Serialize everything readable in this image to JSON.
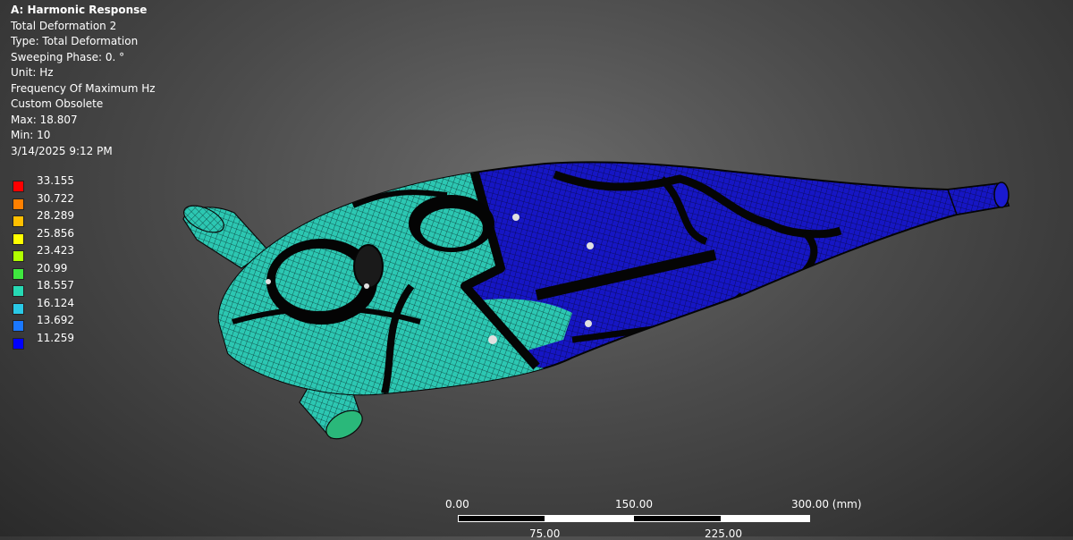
{
  "info": {
    "title": "A: Harmonic Response",
    "result_name": "Total Deformation 2",
    "type": "Type: Total Deformation",
    "sweeping_phase": "Sweeping Phase: 0. °",
    "unit": "Unit: Hz",
    "frequency": "Frequency Of Maximum Hz",
    "custom": "Custom Obsolete",
    "max": "Max: 18.807",
    "min": "Min: 10",
    "timestamp": "3/14/2025 9:12 PM"
  },
  "legend": [
    {
      "value": "33.155",
      "color": "#ff0000"
    },
    {
      "value": "30.722",
      "color": "#ff8000"
    },
    {
      "value": "28.289",
      "color": "#ffbf00"
    },
    {
      "value": "25.856",
      "color": "#ffff00"
    },
    {
      "value": "23.423",
      "color": "#b0ff00"
    },
    {
      "value": "20.99",
      "color": "#3fe83f"
    },
    {
      "value": "18.557",
      "color": "#27d9b4"
    },
    {
      "value": "16.124",
      "color": "#2ac9e6"
    },
    {
      "value": "13.692",
      "color": "#1a78ff"
    },
    {
      "value": "11.259",
      "color": "#0000ff"
    }
  ],
  "scale": {
    "label_0": "0.00",
    "label_150": "150.00",
    "label_300": "300.00 (mm)",
    "label_75": "75.00",
    "label_225": "225.00"
  },
  "colors": {
    "mesh_cyan": "#27c9b4",
    "mesh_blue": "#1010c8",
    "mesh_line": "#0a0a0a",
    "background": "#4b4b4b"
  }
}
